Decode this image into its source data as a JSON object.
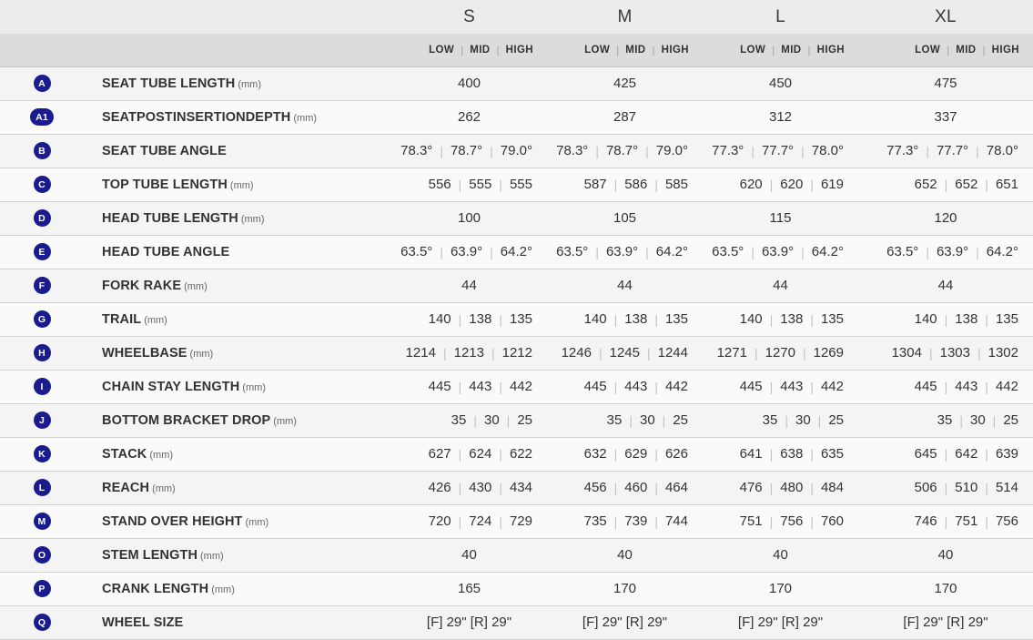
{
  "header": {
    "sizes": [
      "S",
      "M",
      "L",
      "XL"
    ],
    "variants": [
      "LOW",
      "MID",
      "HIGH"
    ],
    "separator": "|"
  },
  "theme": {
    "badge_color": "#191b8f",
    "header_size_bg": "#ececec",
    "header_variant_bg": "#dcdcdc",
    "row_odd_bg": "#f4f4f4",
    "row_even_bg": "#fafafa",
    "row_border": "#d2d2d2"
  },
  "rows": [
    {
      "badge": "A",
      "name": "SEAT TUBE LENGTH",
      "unit": "(mm)",
      "mode": "single",
      "values": [
        "400",
        "425",
        "450",
        "475"
      ]
    },
    {
      "badge": "A1",
      "name": "SEATPOSTINSERTIONDEPTH",
      "unit": "(mm)",
      "mode": "single",
      "values": [
        "262",
        "287",
        "312",
        "337"
      ]
    },
    {
      "badge": "B",
      "name": "SEAT TUBE ANGLE",
      "unit": "",
      "mode": "triple",
      "values": [
        [
          "78.3°",
          "78.7°",
          "79.0°"
        ],
        [
          "78.3°",
          "78.7°",
          "79.0°"
        ],
        [
          "77.3°",
          "77.7°",
          "78.0°"
        ],
        [
          "77.3°",
          "77.7°",
          "78.0°"
        ]
      ]
    },
    {
      "badge": "C",
      "name": "TOP TUBE LENGTH",
      "unit": "(mm)",
      "mode": "triple",
      "values": [
        [
          "556",
          "555",
          "555"
        ],
        [
          "587",
          "586",
          "585"
        ],
        [
          "620",
          "620",
          "619"
        ],
        [
          "652",
          "652",
          "651"
        ]
      ]
    },
    {
      "badge": "D",
      "name": "HEAD TUBE LENGTH",
      "unit": "(mm)",
      "mode": "single",
      "values": [
        "100",
        "105",
        "115",
        "120"
      ]
    },
    {
      "badge": "E",
      "name": "HEAD TUBE ANGLE",
      "unit": "",
      "mode": "triple",
      "values": [
        [
          "63.5°",
          "63.9°",
          "64.2°"
        ],
        [
          "63.5°",
          "63.9°",
          "64.2°"
        ],
        [
          "63.5°",
          "63.9°",
          "64.2°"
        ],
        [
          "63.5°",
          "63.9°",
          "64.2°"
        ]
      ]
    },
    {
      "badge": "F",
      "name": "FORK RAKE",
      "unit": "(mm)",
      "mode": "single",
      "values": [
        "44",
        "44",
        "44",
        "44"
      ]
    },
    {
      "badge": "G",
      "name": "TRAIL",
      "unit": "(mm)",
      "mode": "triple",
      "values": [
        [
          "140",
          "138",
          "135"
        ],
        [
          "140",
          "138",
          "135"
        ],
        [
          "140",
          "138",
          "135"
        ],
        [
          "140",
          "138",
          "135"
        ]
      ]
    },
    {
      "badge": "H",
      "name": "WHEELBASE",
      "unit": "(mm)",
      "mode": "triple",
      "values": [
        [
          "1214",
          "1213",
          "1212"
        ],
        [
          "1246",
          "1245",
          "1244"
        ],
        [
          "1271",
          "1270",
          "1269"
        ],
        [
          "1304",
          "1303",
          "1302"
        ]
      ]
    },
    {
      "badge": "I",
      "name": "CHAIN STAY LENGTH",
      "unit": "(mm)",
      "mode": "triple",
      "values": [
        [
          "445",
          "443",
          "442"
        ],
        [
          "445",
          "443",
          "442"
        ],
        [
          "445",
          "443",
          "442"
        ],
        [
          "445",
          "443",
          "442"
        ]
      ]
    },
    {
      "badge": "J",
      "name": "BOTTOM BRACKET DROP",
      "unit": "(mm)",
      "mode": "triple",
      "values": [
        [
          "35",
          "30",
          "25"
        ],
        [
          "35",
          "30",
          "25"
        ],
        [
          "35",
          "30",
          "25"
        ],
        [
          "35",
          "30",
          "25"
        ]
      ]
    },
    {
      "badge": "K",
      "name": "STACK",
      "unit": "(mm)",
      "mode": "triple",
      "values": [
        [
          "627",
          "624",
          "622"
        ],
        [
          "632",
          "629",
          "626"
        ],
        [
          "641",
          "638",
          "635"
        ],
        [
          "645",
          "642",
          "639"
        ]
      ]
    },
    {
      "badge": "L",
      "name": "REACH",
      "unit": "(mm)",
      "mode": "triple",
      "values": [
        [
          "426",
          "430",
          "434"
        ],
        [
          "456",
          "460",
          "464"
        ],
        [
          "476",
          "480",
          "484"
        ],
        [
          "506",
          "510",
          "514"
        ]
      ]
    },
    {
      "badge": "M",
      "name": "STAND OVER HEIGHT",
      "unit": "(mm)",
      "mode": "triple",
      "values": [
        [
          "720",
          "724",
          "729"
        ],
        [
          "735",
          "739",
          "744"
        ],
        [
          "751",
          "756",
          "760"
        ],
        [
          "746",
          "751",
          "756"
        ]
      ]
    },
    {
      "badge": "O",
      "name": "STEM LENGTH",
      "unit": "(mm)",
      "mode": "single",
      "values": [
        "40",
        "40",
        "40",
        "40"
      ]
    },
    {
      "badge": "P",
      "name": "CRANK LENGTH",
      "unit": "(mm)",
      "mode": "single",
      "values": [
        "165",
        "170",
        "170",
        "170"
      ]
    },
    {
      "badge": "Q",
      "name": "WHEEL SIZE",
      "unit": "",
      "mode": "single",
      "values": [
        "[F] 29\" [R] 29\"",
        "[F] 29\" [R] 29\"",
        "[F] 29\" [R] 29\"",
        "[F] 29\" [R] 29\""
      ]
    }
  ]
}
